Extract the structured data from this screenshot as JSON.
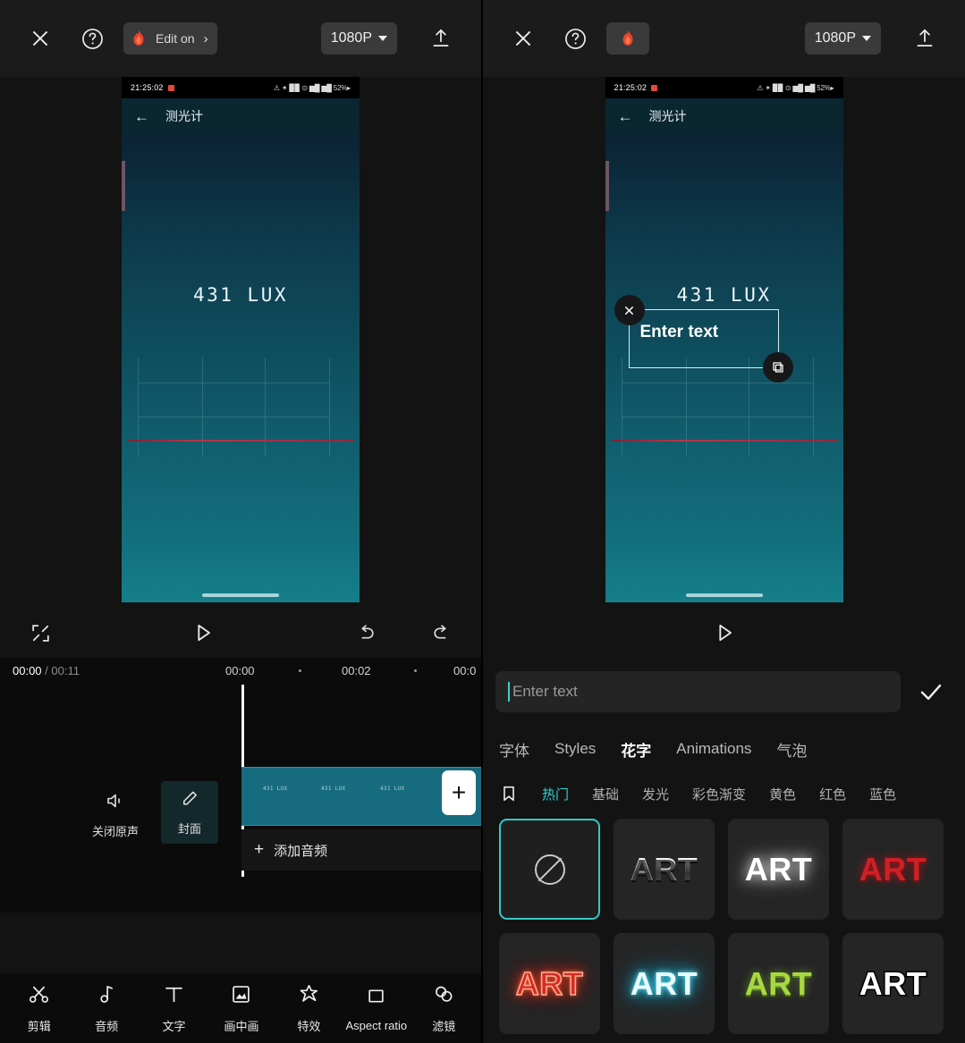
{
  "left_panel": {
    "topbar": {
      "close_icon": "close-icon",
      "help_icon": "help-icon",
      "edit_chip_label": "Edit on",
      "edit_chip_chevron": "›",
      "flame_icon": "flame-icon",
      "resolution": "1080P",
      "upload_icon": "upload-icon"
    },
    "phone": {
      "status_time": "21:25:02",
      "status_right": "⚠ ✶ ▉▉ ⊙ ▆█ ▆█ 52%▸",
      "app_title": "测光计",
      "back_icon": "back-arrow-icon",
      "lux_reading": "431 LUX"
    },
    "player": {
      "fullscreen_icon": "fullscreen-icon",
      "play_icon": "play-icon",
      "undo_icon": "undo-icon",
      "redo_icon": "redo-icon"
    },
    "timeline": {
      "current_time": "00:00",
      "total_time": "00:11",
      "separator": "/",
      "ticks": [
        "00:00",
        "00:02",
        "00:0"
      ],
      "tools": [
        {
          "label": "关闭原声",
          "icon": "mute-icon"
        },
        {
          "label": "封面",
          "icon": "cover-edit-icon"
        }
      ],
      "clip_thumb_labels": [
        "431 LUX",
        "431 LUX",
        "431 LUX"
      ],
      "add_clip_label": "+",
      "add_audio_label": "添加音频",
      "add_audio_plus": "+"
    },
    "bottombar": [
      {
        "label": "剪辑",
        "icon": "cut-icon"
      },
      {
        "label": "音频",
        "icon": "music-note-icon"
      },
      {
        "label": "文字",
        "icon": "text-icon"
      },
      {
        "label": "画中画",
        "icon": "picture-in-picture-icon"
      },
      {
        "label": "特效",
        "icon": "effects-star-icon"
      },
      {
        "label": "Aspect ratio",
        "icon": "aspect-ratio-icon"
      },
      {
        "label": "滤镜",
        "icon": "filter-icon"
      }
    ]
  },
  "right_panel": {
    "topbar": {
      "close_icon": "close-icon",
      "help_icon": "help-icon",
      "flame_icon": "flame-icon",
      "resolution": "1080P",
      "upload_icon": "upload-icon"
    },
    "phone": {
      "status_time": "21:25:02",
      "status_right": "⚠ ✶ ▉▉ ⊙ ▆█ ▆█ 52%▸",
      "app_title": "测光计",
      "back_icon": "back-arrow-icon",
      "lux_reading": "431 LUX",
      "overlay_text": "Enter text",
      "overlay_close_icon": "close-icon",
      "overlay_resize_icon": "resize-handle-icon"
    },
    "player": {
      "play_icon": "play-icon"
    },
    "text_editor": {
      "input_value": "",
      "input_placeholder": "Enter text",
      "confirm_icon": "check-icon",
      "tabs": [
        {
          "label": "字体",
          "active": false
        },
        {
          "label": "Styles",
          "active": false
        },
        {
          "label": "花字",
          "active": true
        },
        {
          "label": "Animations",
          "active": false
        },
        {
          "label": "气泡",
          "active": false
        }
      ],
      "bookmark_icon": "bookmark-icon",
      "subtabs": [
        {
          "label": "热门",
          "active": true
        },
        {
          "label": "基础",
          "active": false
        },
        {
          "label": "发光",
          "active": false
        },
        {
          "label": "彩色渐变",
          "active": false
        },
        {
          "label": "黄色",
          "active": false
        },
        {
          "label": "红色",
          "active": false
        },
        {
          "label": "蓝色",
          "active": false
        }
      ],
      "styles": [
        {
          "name": "none",
          "label": "",
          "style": "none",
          "selected": true
        },
        {
          "name": "silver",
          "label": "ART",
          "style": "art-silver",
          "selected": false
        },
        {
          "name": "white-glow",
          "label": "ART",
          "style": "art-whiteglow",
          "selected": false
        },
        {
          "name": "red",
          "label": "ART",
          "style": "art-red",
          "selected": false
        },
        {
          "name": "red-neon",
          "label": "ART",
          "style": "art-redneon",
          "selected": false
        },
        {
          "name": "cyan-neon",
          "label": "ART",
          "style": "art-cyanneon",
          "selected": false
        },
        {
          "name": "green",
          "label": "ART",
          "style": "art-green",
          "selected": false
        },
        {
          "name": "white-outline",
          "label": "ART",
          "style": "art-outline",
          "selected": false
        }
      ]
    }
  },
  "colors": {
    "accent_cyan": "#34d1cf",
    "clip_teal": "#176b7e",
    "flame_red": "#e8442c",
    "panel_bg": "#131313"
  }
}
